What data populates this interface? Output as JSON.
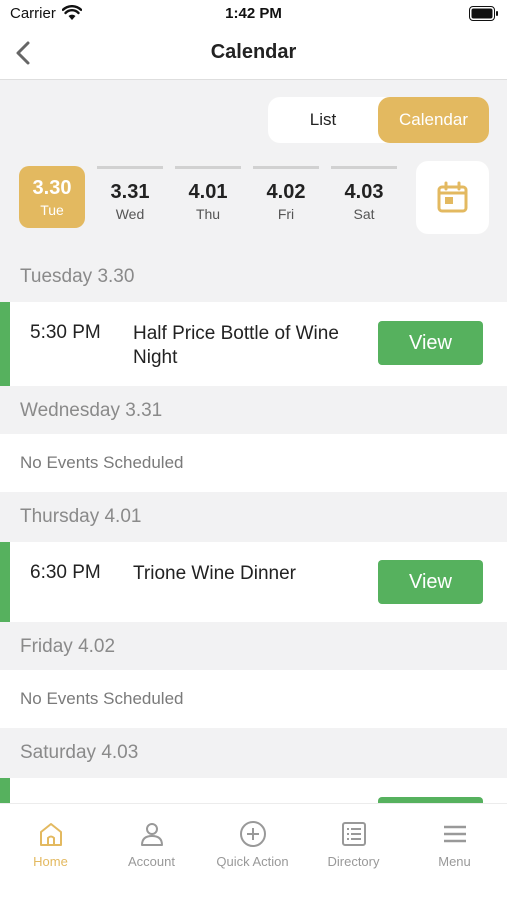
{
  "status_bar": {
    "carrier": "Carrier",
    "time": "1:42 PM"
  },
  "nav": {
    "title": "Calendar"
  },
  "view_toggle": {
    "list_label": "List",
    "calendar_label": "Calendar",
    "selected": "Calendar"
  },
  "day_strip": [
    {
      "date": "3.30",
      "weekday": "Tue",
      "selected": true
    },
    {
      "date": "3.31",
      "weekday": "Wed",
      "selected": false
    },
    {
      "date": "4.01",
      "weekday": "Thu",
      "selected": false
    },
    {
      "date": "4.02",
      "weekday": "Fri",
      "selected": false
    },
    {
      "date": "4.03",
      "weekday": "Sat",
      "selected": false
    }
  ],
  "sections": [
    {
      "header": "Tuesday 3.30",
      "events": [
        {
          "time": "5:30 PM",
          "title": "Half Price Bottle of Wine Night",
          "action": "View"
        }
      ]
    },
    {
      "header": "Wednesday 3.31",
      "empty_text": "No Events Scheduled"
    },
    {
      "header": "Thursday 4.01",
      "events": [
        {
          "time": "6:30 PM",
          "title": "Trione Wine Dinner",
          "action": "View"
        }
      ]
    },
    {
      "header": "Friday 4.02",
      "empty_text": "No Events Scheduled"
    },
    {
      "header": "Saturday 4.03"
    }
  ],
  "tab_bar": [
    {
      "label": "Home",
      "icon": "home-icon",
      "active": true
    },
    {
      "label": "Account",
      "icon": "person-icon",
      "active": false
    },
    {
      "label": "Quick Action",
      "icon": "plus-circle-icon",
      "active": false
    },
    {
      "label": "Directory",
      "icon": "list-icon",
      "active": false
    },
    {
      "label": "Menu",
      "icon": "hamburger-icon",
      "active": false
    }
  ],
  "colors": {
    "accent_gold": "#e3b960",
    "event_green": "#56b15e",
    "background": "#f2f2f3"
  }
}
